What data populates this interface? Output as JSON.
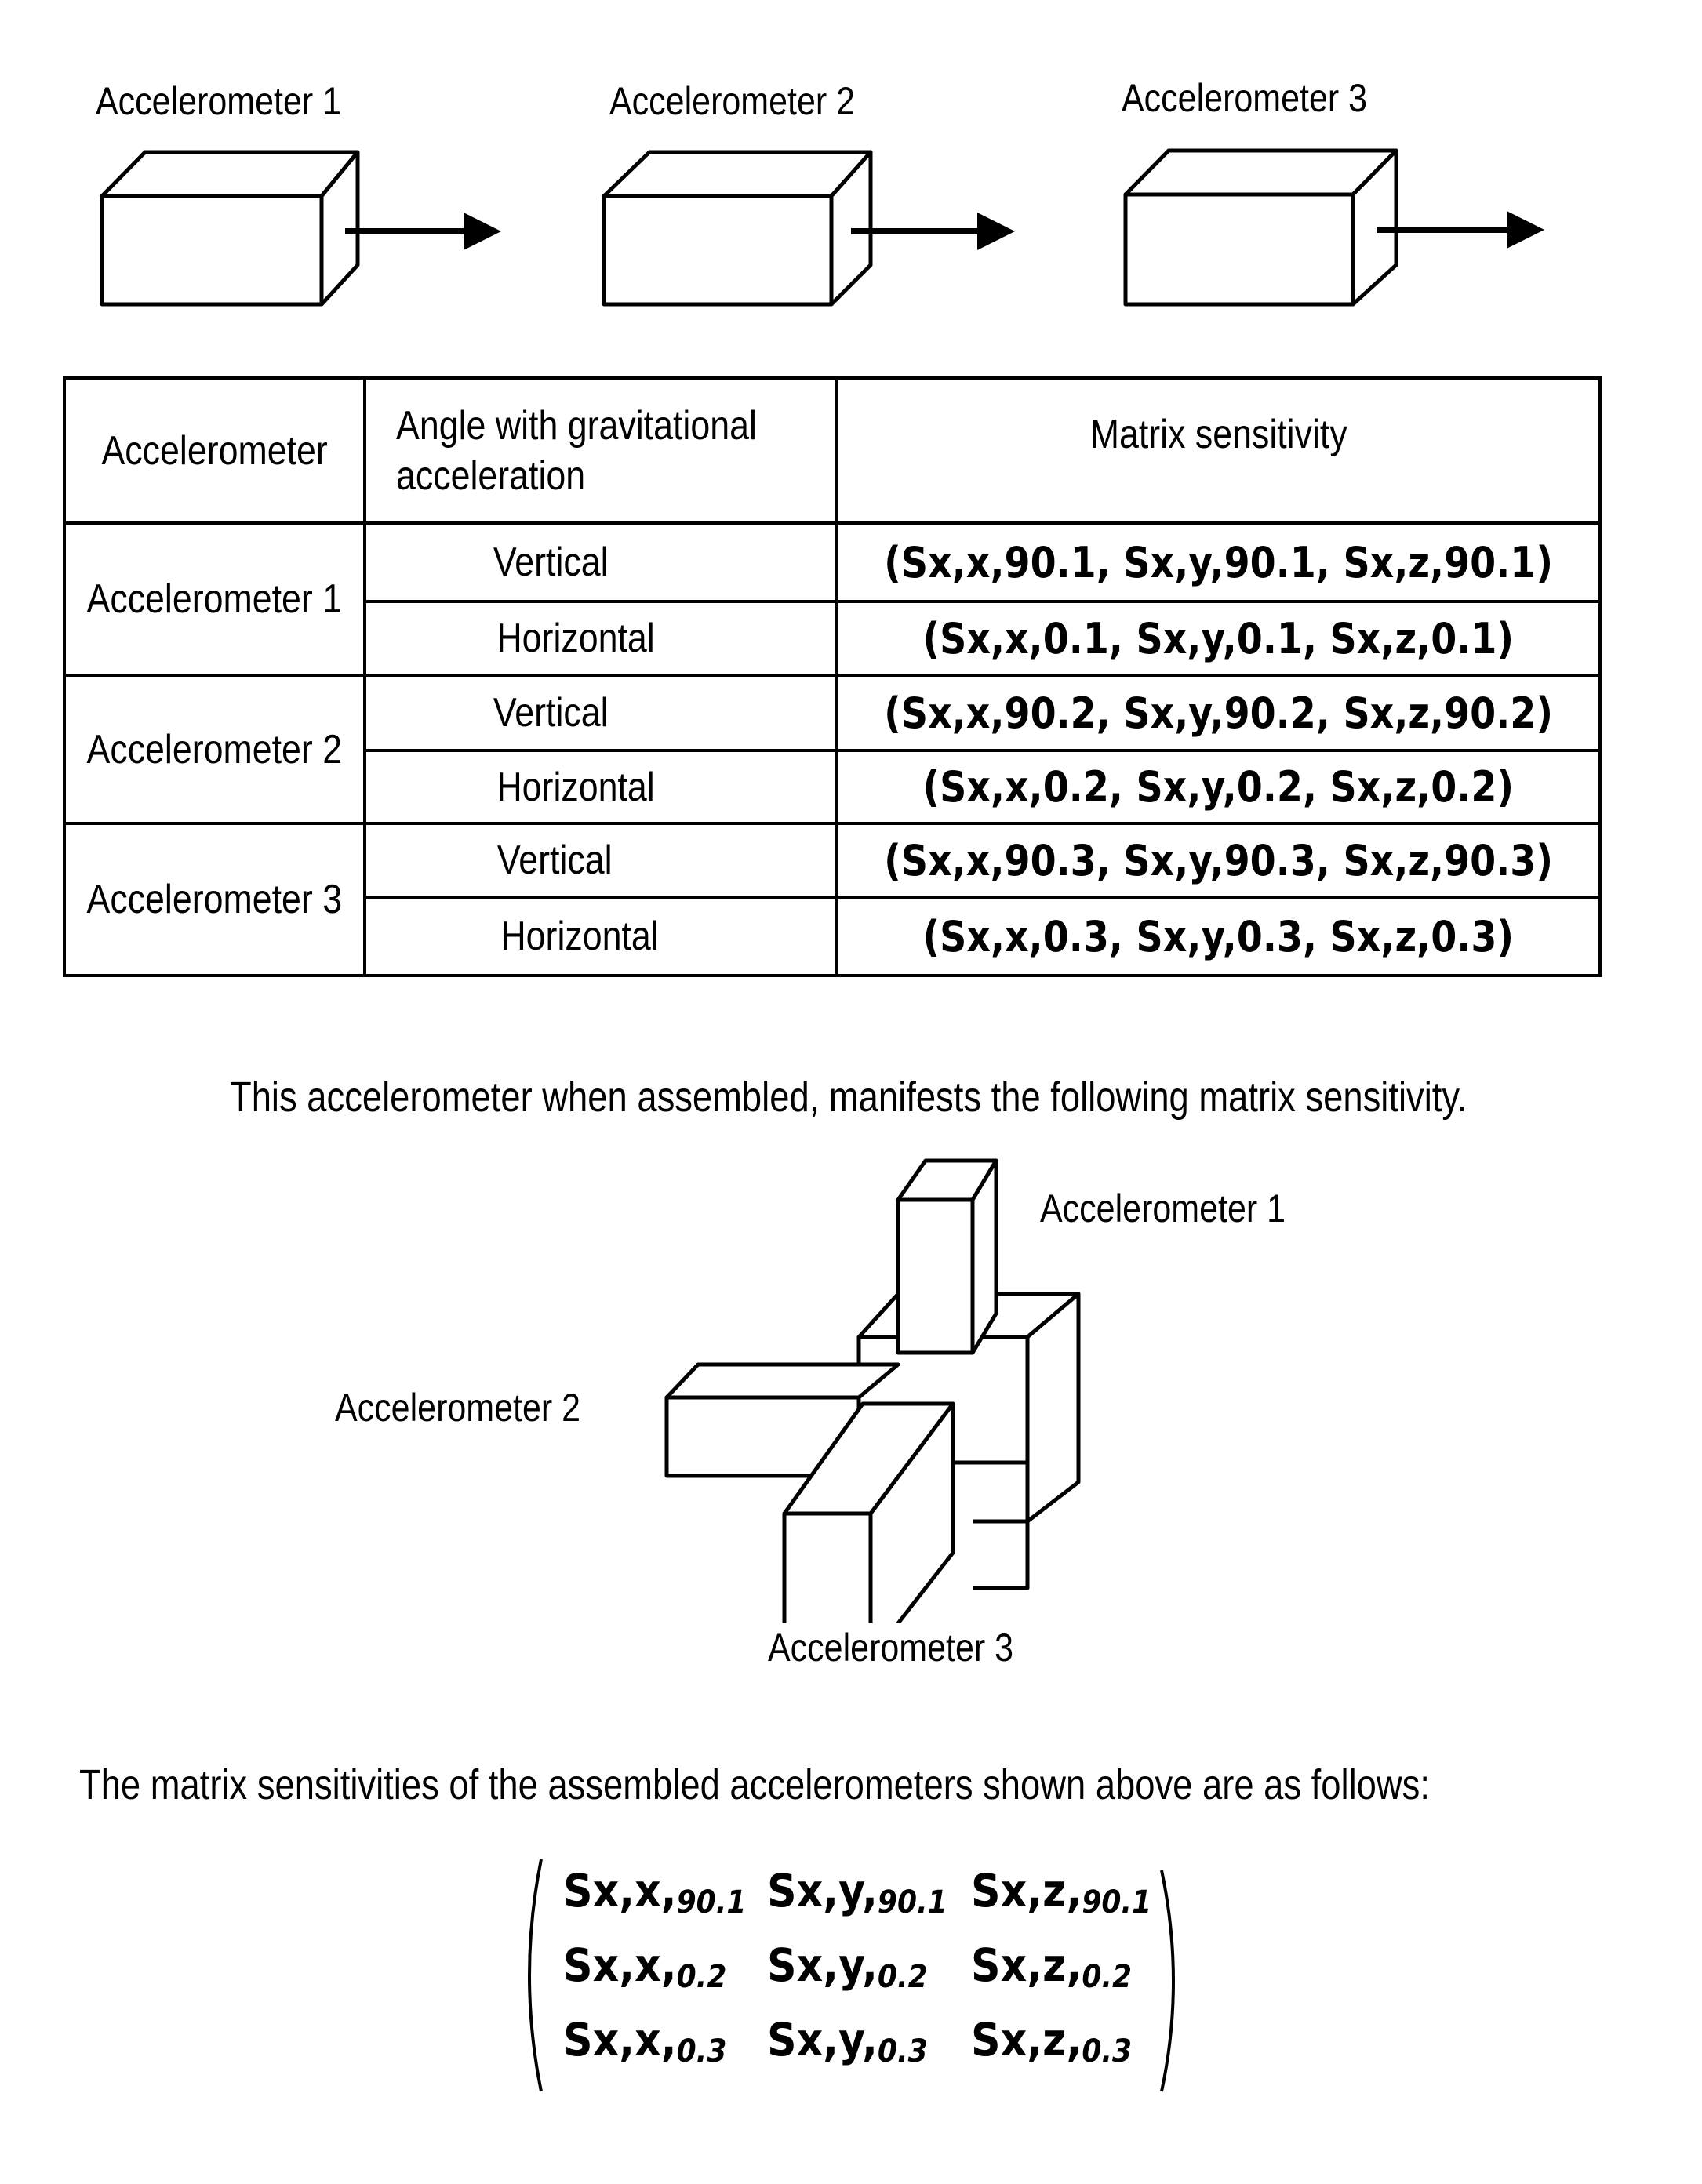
{
  "top_figure": {
    "units": [
      {
        "label": "Accelerometer 1"
      },
      {
        "label": "Accelerometer 2"
      },
      {
        "label": "Accelerometer 3"
      }
    ]
  },
  "table": {
    "headers": [
      "Accelerometer",
      "Angle with gravitational acceleration",
      "Matrix sensitivity"
    ],
    "groups": [
      {
        "accelerometer": "Accelerometer 1",
        "rows": [
          {
            "angle": "Vertical",
            "sensitivity": [
              "Sx,x,90.1",
              "Sx,y,90.1",
              "Sx,z,90.1"
            ]
          },
          {
            "angle": "Horizontal",
            "sensitivity": [
              "Sx,x,0.1",
              "Sx,y,0.1",
              "Sx,z,0.1"
            ]
          }
        ]
      },
      {
        "accelerometer": "Accelerometer 2",
        "rows": [
          {
            "angle": "Vertical",
            "sensitivity": [
              "Sx,x,90.2",
              "Sx,y,90.2",
              "Sx,z,90.2"
            ]
          },
          {
            "angle": "Horizontal",
            "sensitivity": [
              "Sx,x,0.2",
              "Sx,y,0.2",
              "Sx,z,0.2"
            ]
          }
        ]
      },
      {
        "accelerometer": "Accelerometer 3",
        "rows": [
          {
            "angle": "Vertical",
            "sensitivity": [
              "Sx,x,90.3",
              "Sx,y,90.3",
              "Sx,z,90.3"
            ]
          },
          {
            "angle": "Horizontal",
            "sensitivity": [
              "Sx,x,0.3",
              "Sx,y,0.3",
              "Sx,z,0.3"
            ]
          }
        ]
      }
    ],
    "sensitivity_text": [
      "(Sx,x,90.1, Sx,y,90.1, Sx,z,90.1)",
      "(Sx,x,0.1, Sx,y,0.1, Sx,z,0.1)",
      "(Sx,x,90.2, Sx,y,90.2, Sx,z,90.2)",
      "(Sx,x,0.2, Sx,y,0.2, Sx,z,0.2)",
      "(Sx,x,90.3, Sx,y,90.3, Sx,z,90.3)",
      "(Sx,x,0.3, Sx,y,0.3, Sx,z,0.3)"
    ]
  },
  "assembled_sentence": "This accelerometer when assembled, manifests the following matrix sensitivity.",
  "assembly_figure": {
    "labels": [
      "Accelerometer 1",
      "Accelerometer 2",
      "Accelerometer 3"
    ]
  },
  "matrix_sentence": "The matrix sensitivities of the assembled accelerometers shown above are as follows:",
  "matrix": [
    [
      {
        "s": "Sx,x,",
        "sub": "90.1"
      },
      {
        "s": "Sx,y,",
        "sub": "90.1"
      },
      {
        "s": "Sx,z,",
        "sub": "90.1"
      }
    ],
    [
      {
        "s": "Sx,x,",
        "sub": "0.2"
      },
      {
        "s": "Sx,y,",
        "sub": "0.2"
      },
      {
        "s": "Sx,z,",
        "sub": "0.2"
      }
    ],
    [
      {
        "s": "Sx,x,",
        "sub": "0.3"
      },
      {
        "s": "Sx,y,",
        "sub": "0.3"
      },
      {
        "s": "Sx,z,",
        "sub": "0.3"
      }
    ]
  ]
}
